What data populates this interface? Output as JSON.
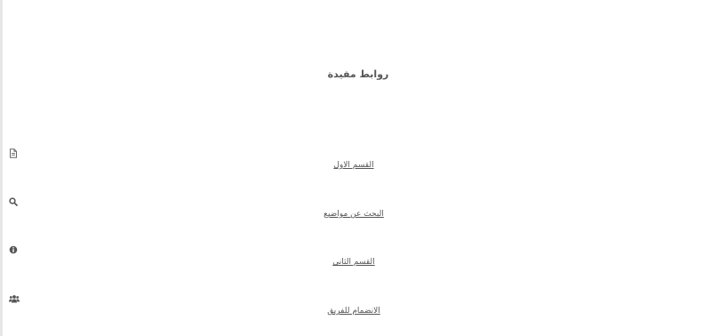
{
  "title": "روابط مفيدة",
  "links": [
    {
      "label": "القسم الاول",
      "icon": "document-icon"
    },
    {
      "label": "البحث عن مواضيع",
      "icon": "search-icon"
    },
    {
      "label": "القسم الثاني",
      "icon": "info-icon"
    },
    {
      "label": "الانضمام للفريق",
      "icon": "users-icon"
    }
  ]
}
